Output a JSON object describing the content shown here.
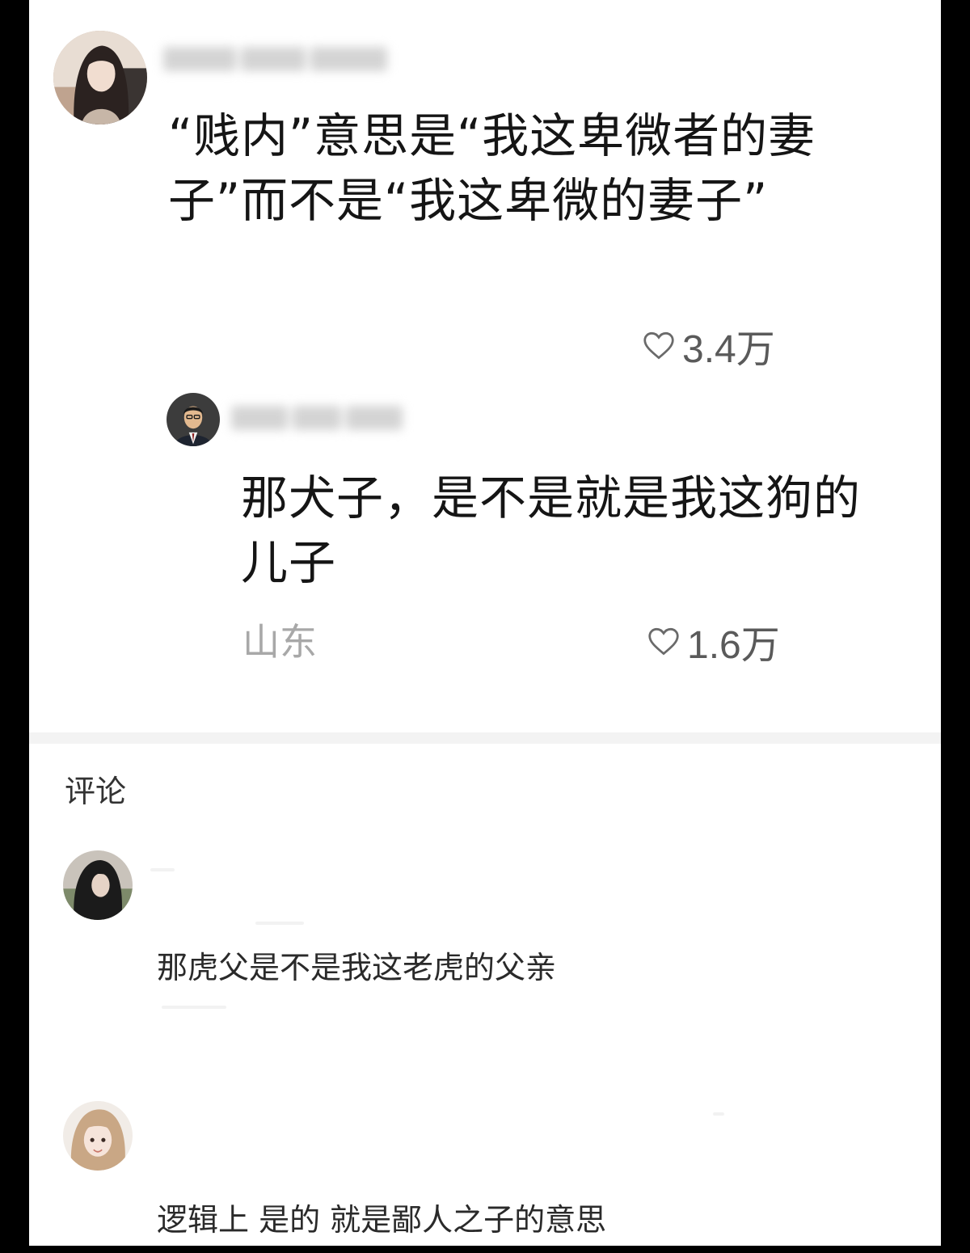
{
  "top_comment": {
    "avatar_icon": "avatar-woman-icon",
    "text": "“贱内”意思是“我这卑微者的妻子”而不是“我这卑微的妻子”",
    "likes": "3.4万"
  },
  "reply": {
    "avatar_icon": "avatar-man-suit-icon",
    "text": "那犬子，是不是就是我这狗的儿子",
    "location": "山东",
    "likes": "1.6万"
  },
  "comments_section": {
    "title": "评论",
    "items": [
      {
        "avatar_icon": "avatar-girl-icon",
        "text": "那虎父是不是我这老虎的父亲"
      },
      {
        "avatar_icon": "avatar-girl-blonde-icon",
        "text": "逻辑上 是的 就是鄙人之子的意思"
      }
    ]
  },
  "colors": {
    "background": "#ffffff",
    "frame": "#000000",
    "text_primary": "#151515",
    "text_secondary": "#a8a8a8"
  }
}
